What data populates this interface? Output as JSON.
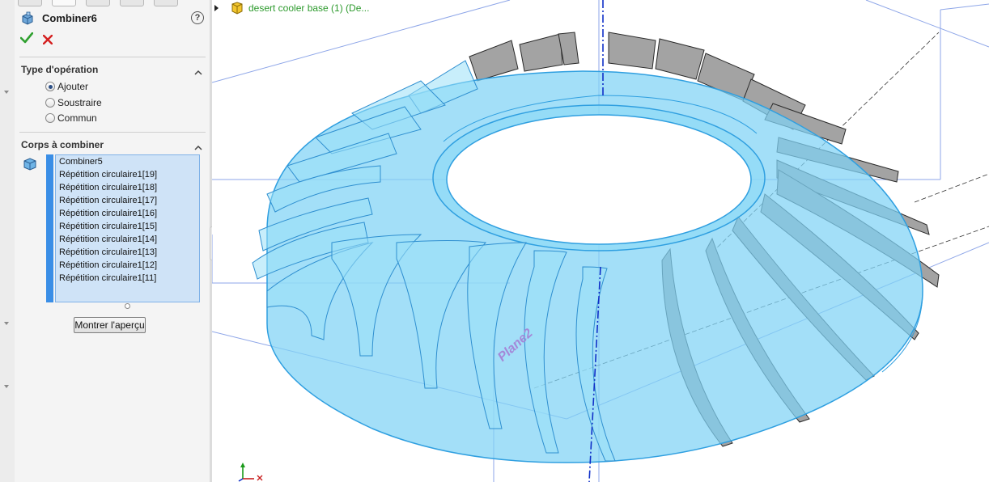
{
  "feature_manager": {
    "title": "Combiner6",
    "help_glyph": "?",
    "ok_icon": "green-check-icon",
    "cancel_icon": "red-x-icon"
  },
  "operation_type": {
    "title": "Type d'opération",
    "options": [
      {
        "label": "Ajouter",
        "selected": true
      },
      {
        "label": "Soustraire",
        "selected": false
      },
      {
        "label": "Commun",
        "selected": false
      }
    ]
  },
  "bodies_to_combine": {
    "title": "Corps à combiner",
    "items": [
      "Combiner5",
      "Répétition circulaire1[19]",
      "Répétition circulaire1[18]",
      "Répétition circulaire1[17]",
      "Répétition circulaire1[16]",
      "Répétition circulaire1[15]",
      "Répétition circulaire1[14]",
      "Répétition circulaire1[13]",
      "Répétition circulaire1[12]",
      "Répétition circulaire1[11]"
    ],
    "preview_button_label": "Montrer l'aperçu"
  },
  "viewport": {
    "tree_label": "desert cooler base (1)  (De...",
    "plane_label": "Plane2",
    "colors": {
      "body_transparent": "#7fd3f5",
      "body_edge": "#2f9fe0",
      "blade_gray": "#9c9c9c",
      "plane_line": "#8ea6e8",
      "axis": "#1030c8",
      "tree_text": "#2d9a2d"
    }
  }
}
